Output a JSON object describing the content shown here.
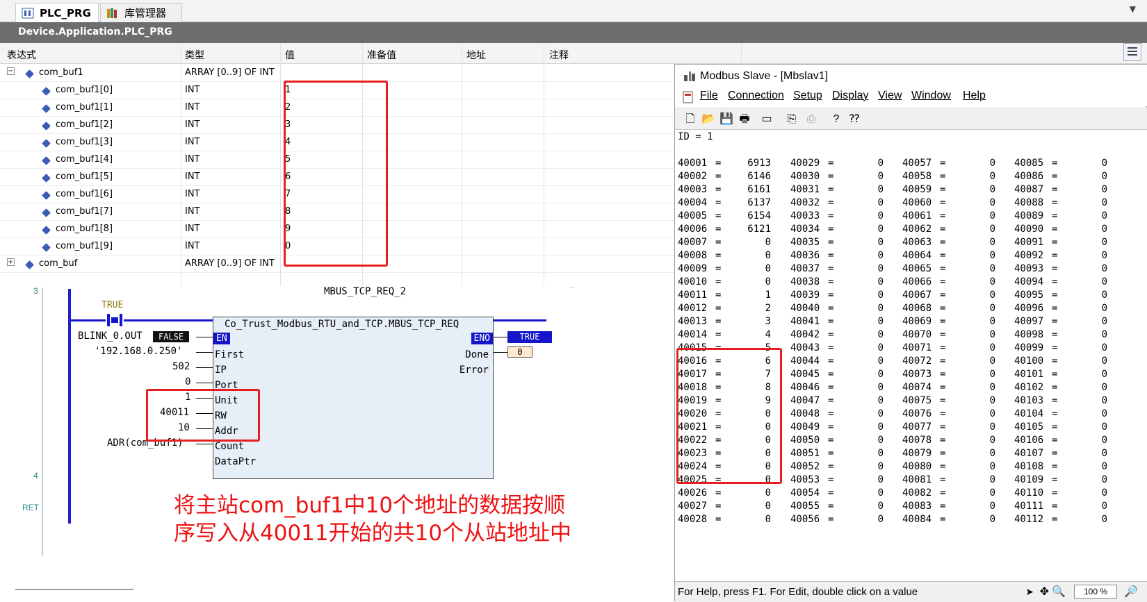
{
  "tabs": [
    {
      "label": "PLC_PRG",
      "close": "×"
    },
    {
      "label": "库管理器"
    }
  ],
  "path": "Device.Application.PLC_PRG",
  "watch": {
    "headers": [
      "表达式",
      "类型",
      "值",
      "准备值",
      "地址",
      "注释"
    ],
    "rows": [
      {
        "expr": "com_buf1",
        "type": "ARRAY [0..9] OF INT",
        "value": "",
        "expander": "−"
      },
      {
        "expr": "com_buf1[0]",
        "type": "INT",
        "value": "1"
      },
      {
        "expr": "com_buf1[1]",
        "type": "INT",
        "value": "2"
      },
      {
        "expr": "com_buf1[2]",
        "type": "INT",
        "value": "3"
      },
      {
        "expr": "com_buf1[3]",
        "type": "INT",
        "value": "4"
      },
      {
        "expr": "com_buf1[4]",
        "type": "INT",
        "value": "5"
      },
      {
        "expr": "com_buf1[5]",
        "type": "INT",
        "value": "6"
      },
      {
        "expr": "com_buf1[6]",
        "type": "INT",
        "value": "7"
      },
      {
        "expr": "com_buf1[7]",
        "type": "INT",
        "value": "8"
      },
      {
        "expr": "com_buf1[8]",
        "type": "INT",
        "value": "9"
      },
      {
        "expr": "com_buf1[9]",
        "type": "INT",
        "value": "0"
      },
      {
        "expr": "com_buf",
        "type": "ARRAY [0..9] OF INT",
        "value": "",
        "expander": "+"
      }
    ]
  },
  "ladder": {
    "rung3": "3",
    "rung4": "4",
    "ret": "RET",
    "contact_value": "TRUE",
    "instance": "MBUS_TCP_REQ_2",
    "fb_type": "Co_Trust_Modbus_RTU_and_TCP.MBUS_TCP_REQ",
    "en": "EN",
    "eno": "ENO",
    "inputs": [
      {
        "pin": "First",
        "arg": "BLINK_0.OUT"
      },
      {
        "pin": "IP",
        "arg": "'192.168.0.250'"
      },
      {
        "pin": "Port",
        "arg": "502"
      },
      {
        "pin": "Unit",
        "arg": "0"
      },
      {
        "pin": "RW",
        "arg": "1"
      },
      {
        "pin": "Addr",
        "arg": "40011"
      },
      {
        "pin": "Count",
        "arg": "10"
      },
      {
        "pin": "DataPtr",
        "arg": "ADR(com_buf1)"
      }
    ],
    "first_value": "FALSE",
    "outputs": [
      {
        "pin": "Done",
        "value": "TRUE"
      },
      {
        "pin": "Error",
        "value": "0"
      }
    ],
    "annotation_line1": "将主站com_buf1中10个地址的数据按顺",
    "annotation_line2": "序写入从40011开始的共10个从站地址中"
  },
  "modbus": {
    "title": "Modbus Slave - [Mbslav1]",
    "menu": [
      "File",
      "Connection",
      "Setup",
      "Display",
      "View",
      "Window",
      "Help"
    ],
    "id_line": "ID = 1",
    "col1": [
      [
        "40001",
        "6913"
      ],
      [
        "40002",
        "6146"
      ],
      [
        "40003",
        "6161"
      ],
      [
        "40004",
        "6137"
      ],
      [
        "40005",
        "6154"
      ],
      [
        "40006",
        "6121"
      ],
      [
        "40007",
        "0"
      ],
      [
        "40008",
        "0"
      ],
      [
        "40009",
        "0"
      ],
      [
        "40010",
        "0"
      ],
      [
        "40011",
        "1"
      ],
      [
        "40012",
        "2"
      ],
      [
        "40013",
        "3"
      ],
      [
        "40014",
        "4"
      ],
      [
        "40015",
        "5"
      ],
      [
        "40016",
        "6"
      ],
      [
        "40017",
        "7"
      ],
      [
        "40018",
        "8"
      ],
      [
        "40019",
        "9"
      ],
      [
        "40020",
        "0"
      ],
      [
        "40021",
        "0"
      ],
      [
        "40022",
        "0"
      ],
      [
        "40023",
        "0"
      ],
      [
        "40024",
        "0"
      ],
      [
        "40025",
        "0"
      ],
      [
        "40026",
        "0"
      ],
      [
        "40027",
        "0"
      ],
      [
        "40028",
        "0"
      ]
    ],
    "col2": [
      [
        "40029",
        "0"
      ],
      [
        "40030",
        "0"
      ],
      [
        "40031",
        "0"
      ],
      [
        "40032",
        "0"
      ],
      [
        "40033",
        "0"
      ],
      [
        "40034",
        "0"
      ],
      [
        "40035",
        "0"
      ],
      [
        "40036",
        "0"
      ],
      [
        "40037",
        "0"
      ],
      [
        "40038",
        "0"
      ],
      [
        "40039",
        "0"
      ],
      [
        "40040",
        "0"
      ],
      [
        "40041",
        "0"
      ],
      [
        "40042",
        "0"
      ],
      [
        "40043",
        "0"
      ],
      [
        "40044",
        "0"
      ],
      [
        "40045",
        "0"
      ],
      [
        "40046",
        "0"
      ],
      [
        "40047",
        "0"
      ],
      [
        "40048",
        "0"
      ],
      [
        "40049",
        "0"
      ],
      [
        "40050",
        "0"
      ],
      [
        "40051",
        "0"
      ],
      [
        "40052",
        "0"
      ],
      [
        "40053",
        "0"
      ],
      [
        "40054",
        "0"
      ],
      [
        "40055",
        "0"
      ],
      [
        "40056",
        "0"
      ]
    ],
    "col3": [
      [
        "40057",
        "0"
      ],
      [
        "40058",
        "0"
      ],
      [
        "40059",
        "0"
      ],
      [
        "40060",
        "0"
      ],
      [
        "40061",
        "0"
      ],
      [
        "40062",
        "0"
      ],
      [
        "40063",
        "0"
      ],
      [
        "40064",
        "0"
      ],
      [
        "40065",
        "0"
      ],
      [
        "40066",
        "0"
      ],
      [
        "40067",
        "0"
      ],
      [
        "40068",
        "0"
      ],
      [
        "40069",
        "0"
      ],
      [
        "40070",
        "0"
      ],
      [
        "40071",
        "0"
      ],
      [
        "40072",
        "0"
      ],
      [
        "40073",
        "0"
      ],
      [
        "40074",
        "0"
      ],
      [
        "40075",
        "0"
      ],
      [
        "40076",
        "0"
      ],
      [
        "40077",
        "0"
      ],
      [
        "40078",
        "0"
      ],
      [
        "40079",
        "0"
      ],
      [
        "40080",
        "0"
      ],
      [
        "40081",
        "0"
      ],
      [
        "40082",
        "0"
      ],
      [
        "40083",
        "0"
      ],
      [
        "40084",
        "0"
      ]
    ],
    "col4": [
      [
        "40085",
        "0"
      ],
      [
        "40086",
        "0"
      ],
      [
        "40087",
        "0"
      ],
      [
        "40088",
        "0"
      ],
      [
        "40089",
        "0"
      ],
      [
        "40090",
        "0"
      ],
      [
        "40091",
        "0"
      ],
      [
        "40092",
        "0"
      ],
      [
        "40093",
        "0"
      ],
      [
        "40094",
        "0"
      ],
      [
        "40095",
        "0"
      ],
      [
        "40096",
        "0"
      ],
      [
        "40097",
        "0"
      ],
      [
        "40098",
        "0"
      ],
      [
        "40099",
        "0"
      ],
      [
        "40100",
        "0"
      ],
      [
        "40101",
        "0"
      ],
      [
        "40102",
        "0"
      ],
      [
        "40103",
        "0"
      ],
      [
        "40104",
        "0"
      ],
      [
        "40105",
        "0"
      ],
      [
        "40106",
        "0"
      ],
      [
        "40107",
        "0"
      ],
      [
        "40108",
        "0"
      ],
      [
        "40109",
        "0"
      ],
      [
        "40110",
        "0"
      ],
      [
        "40111",
        "0"
      ],
      [
        "40112",
        "0"
      ]
    ],
    "status": "For Help, press F1.   For Edit, double click on a value",
    "zoom": "100 %"
  },
  "colors": {
    "highlight": "#e81e1e",
    "annotation": "#ee1111",
    "signal": "#1414c8"
  }
}
